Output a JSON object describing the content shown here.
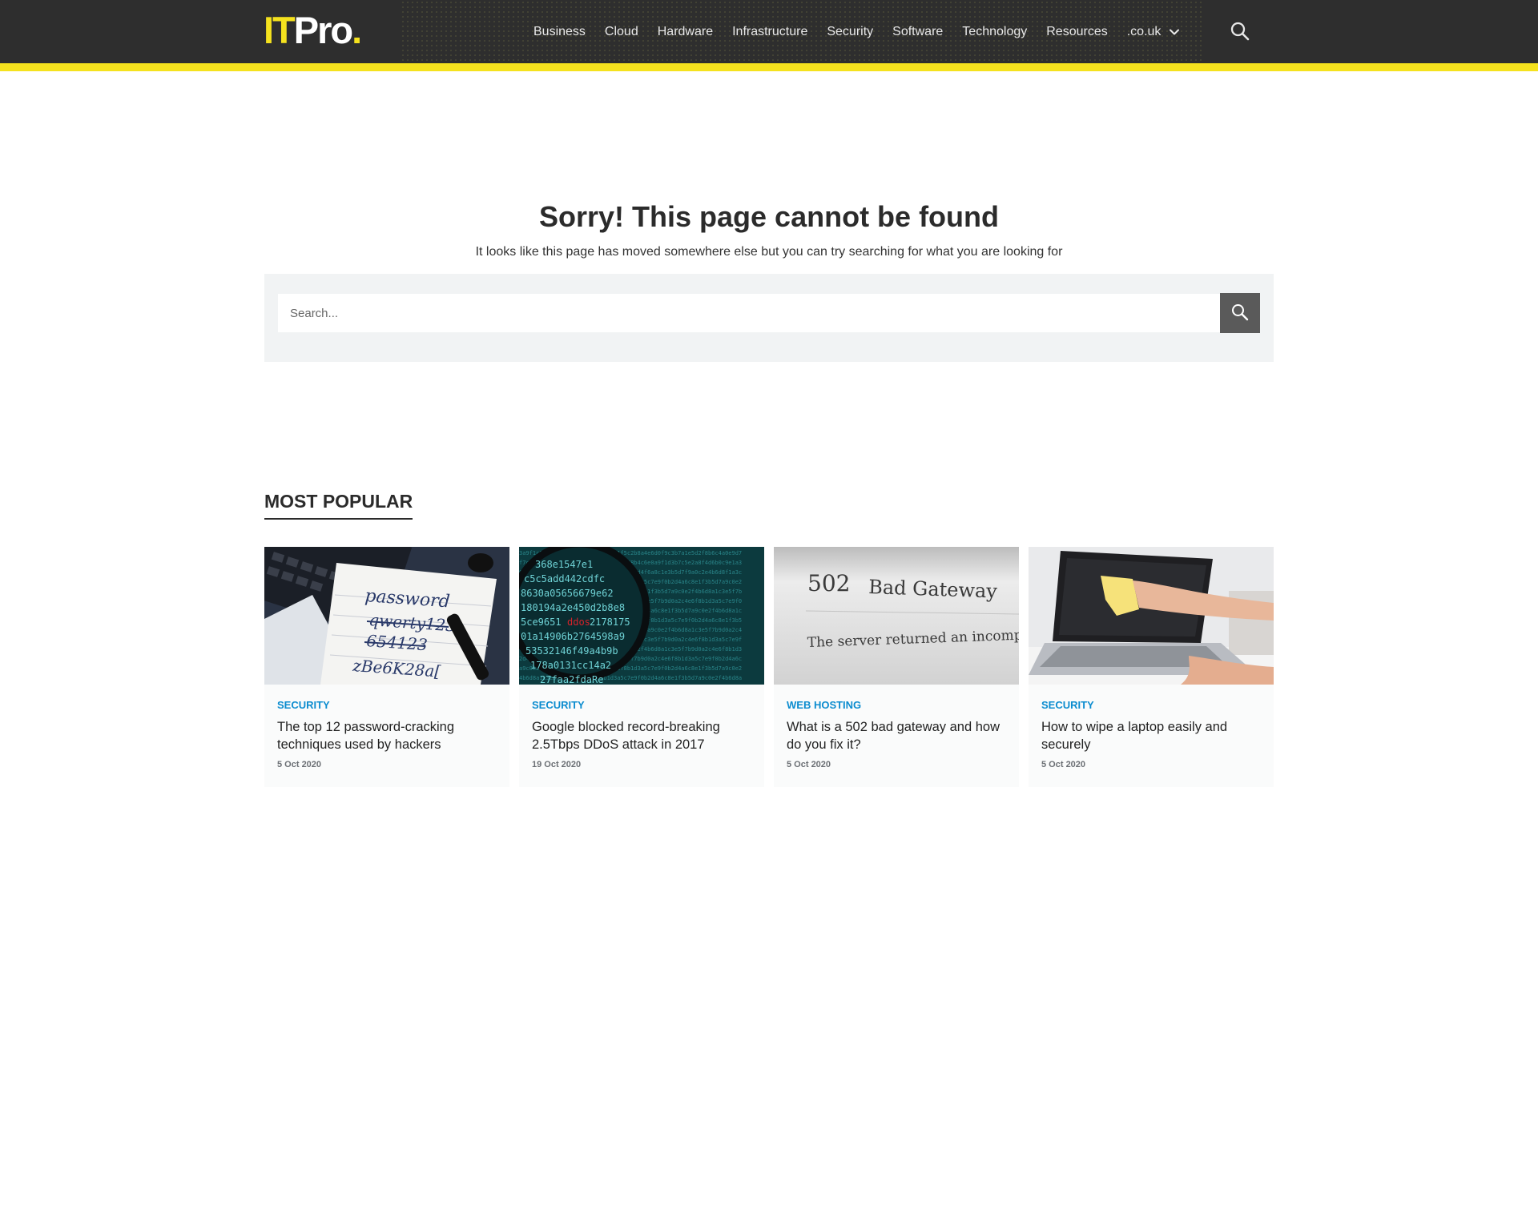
{
  "header": {
    "logo": {
      "it": "IT",
      "pro": "Pro",
      "dot": "."
    },
    "nav": [
      "Business",
      "Cloud",
      "Hardware",
      "Infrastructure",
      "Security",
      "Software",
      "Technology",
      "Resources"
    ],
    "region": ".co.uk",
    "icons": {
      "region_toggle": "chevron-down-icon",
      "search": "search-icon"
    },
    "colors": {
      "bar": "#2e2e2e",
      "accent": "#f5e21e"
    }
  },
  "not_found": {
    "title": "Sorry! This page cannot be found",
    "subtitle": "It looks like this page has moved somewhere else but you can try searching for what you are looking for"
  },
  "search": {
    "placeholder": "Search..."
  },
  "most_popular": {
    "heading": "MOST POPULAR",
    "cards": [
      {
        "category": "SECURITY",
        "title": "The top 12 password-cracking techniques used by hackers",
        "date": "5 Oct 2020",
        "image": "notebook-passwords-image"
      },
      {
        "category": "SECURITY",
        "title": "Google blocked record-breaking 2.5Tbps DDoS attack in 2017",
        "date": "19 Oct 2020",
        "image": "ddos-magnifier-image"
      },
      {
        "category": "WEB HOSTING",
        "title": "What is a 502 bad gateway and how do you fix it?",
        "date": "5 Oct 2020",
        "image": "bad-gateway-image"
      },
      {
        "category": "SECURITY",
        "title": "How to wipe a laptop easily and securely",
        "date": "5 Oct 2020",
        "image": "laptop-wipe-image"
      }
    ],
    "colors": {
      "category": "#0b8ccf",
      "date": "#6b6f74"
    }
  }
}
